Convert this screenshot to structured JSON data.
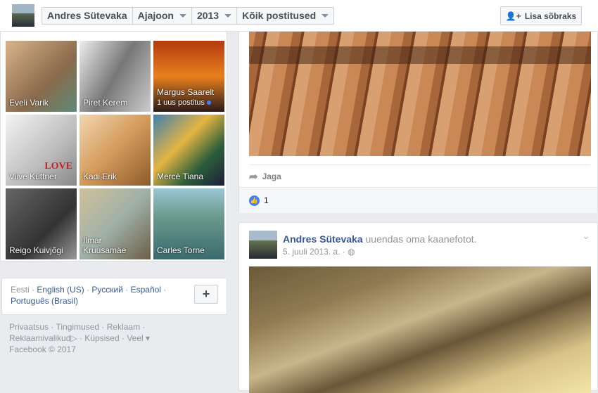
{
  "header": {
    "crumbs": [
      "Andres Sütevaka",
      "Ajajoon",
      "2013",
      "Kõik postitused"
    ],
    "add_friend": "Lisa sõbraks"
  },
  "friends": [
    {
      "name": "Eveli Varik"
    },
    {
      "name": "Piret Kerem"
    },
    {
      "name": "Margus Saarelt",
      "sub": "1 uus postitus"
    },
    {
      "name": "Viive Küttner",
      "overlay": "LOVE"
    },
    {
      "name": "Kadi Erik"
    },
    {
      "name": "Mercè Tiana"
    },
    {
      "name": "Reigo Kuivjõgi"
    },
    {
      "name": "Ilmar Kruusamäe"
    },
    {
      "name": "Carles Torne"
    }
  ],
  "languages": {
    "current": "Eesti",
    "links": [
      "English (US)",
      "Русский",
      "Español",
      "Português (Brasil)"
    ],
    "add": "+"
  },
  "footer": {
    "links": [
      "Privaatsus",
      "Tingimused",
      "Reklaam",
      "Reklaamivalikud",
      "Küpsised",
      "Veel"
    ],
    "copyright": "Facebook © 2017"
  },
  "post1": {
    "share": "Jaga",
    "likes": "1"
  },
  "post2": {
    "author": "Andres Sütevaka",
    "action": "uuendas oma kaanefotot.",
    "date": "5. juuli 2013. a. ·"
  }
}
